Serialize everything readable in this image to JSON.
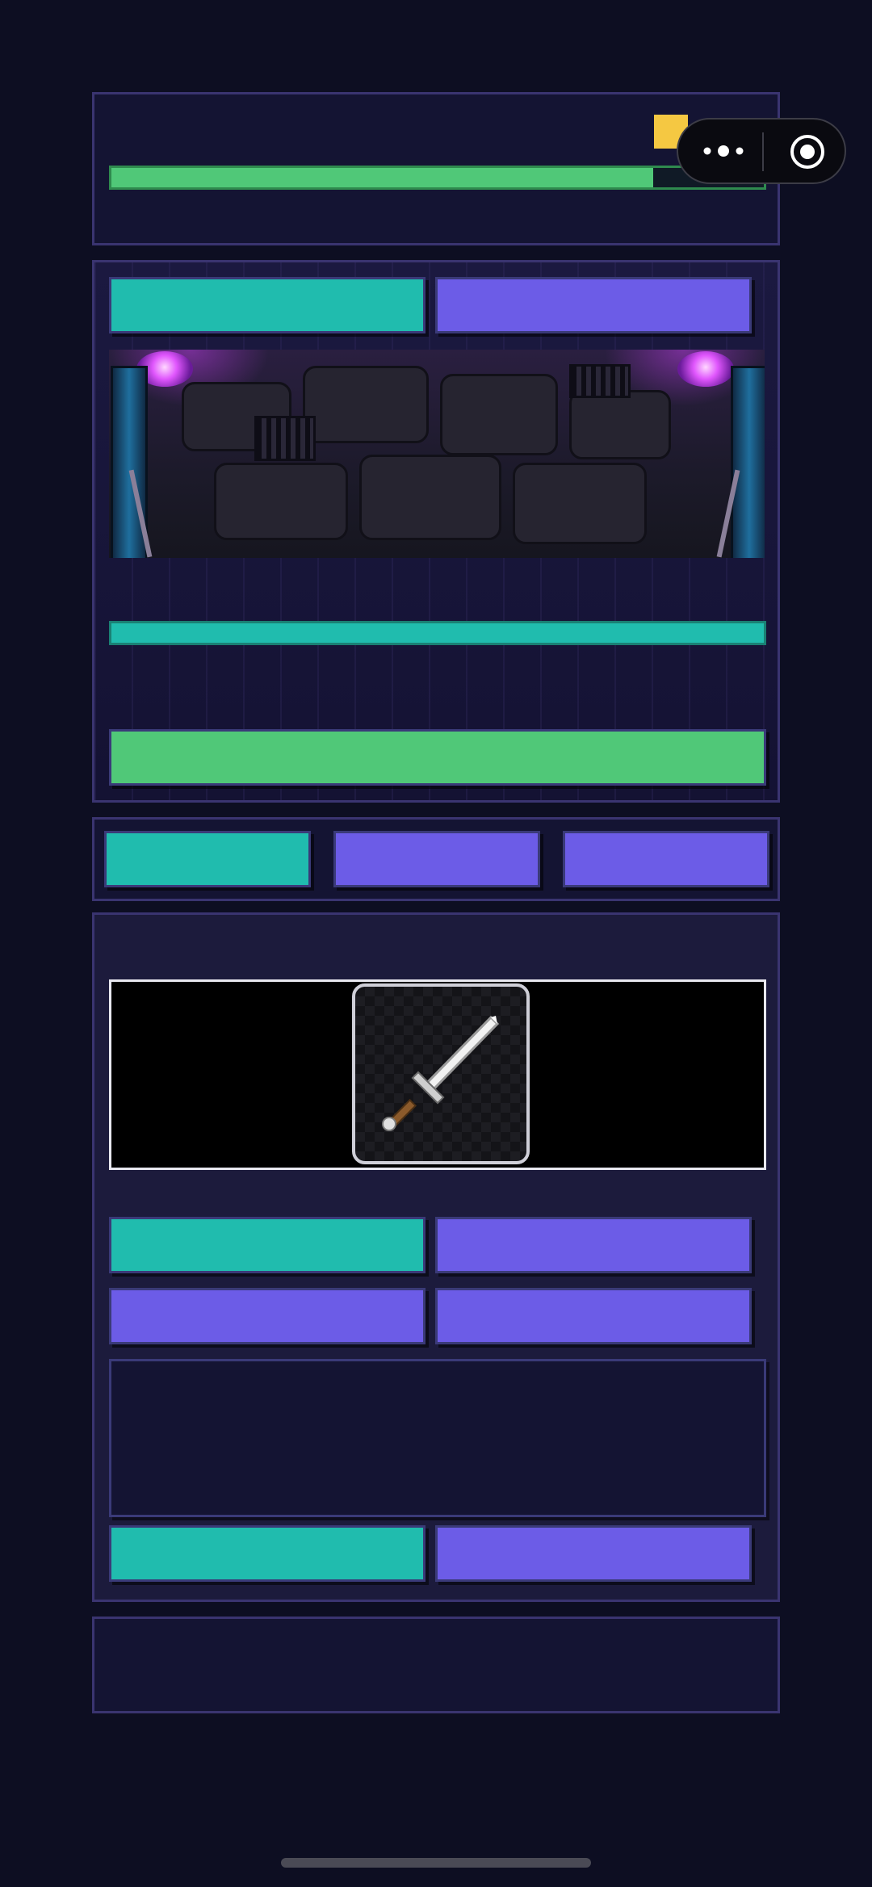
{
  "status": {
    "xp_progress": 0.83,
    "icons": {
      "gold": "gold-coin-icon"
    }
  },
  "battle": {
    "tabs": [
      {
        "label": "",
        "color": "#20bcae"
      },
      {
        "label": "",
        "color": "#6c5ce7"
      }
    ],
    "enemy_hp_progress": 1.0,
    "attack_label": ""
  },
  "nav": {
    "buttons": [
      {
        "label": "",
        "color": "#20bcae"
      },
      {
        "label": "",
        "color": "#6c5ce7"
      },
      {
        "label": "",
        "color": "#6c5ce7"
      }
    ]
  },
  "loot": {
    "item_icon": "sword-icon",
    "actions": [
      {
        "label": "",
        "color": "#20bcae"
      },
      {
        "label": "",
        "color": "#6c5ce7"
      },
      {
        "label": "",
        "color": "#6c5ce7"
      },
      {
        "label": "",
        "color": "#6c5ce7"
      }
    ],
    "description": "",
    "bottom_actions": [
      {
        "label": "",
        "color": "#20bcae"
      },
      {
        "label": "",
        "color": "#6c5ce7"
      }
    ]
  },
  "footer": {
    "text": ""
  },
  "colors": {
    "background": "#0d0e22",
    "panel": "#141433",
    "border": "#3a3470",
    "teal": "#20bcae",
    "purple": "#6c5ce7",
    "green": "#50c878",
    "gold": "#f5c842"
  },
  "system": {
    "capsule_icons": [
      "more-icon",
      "target-icon"
    ]
  }
}
